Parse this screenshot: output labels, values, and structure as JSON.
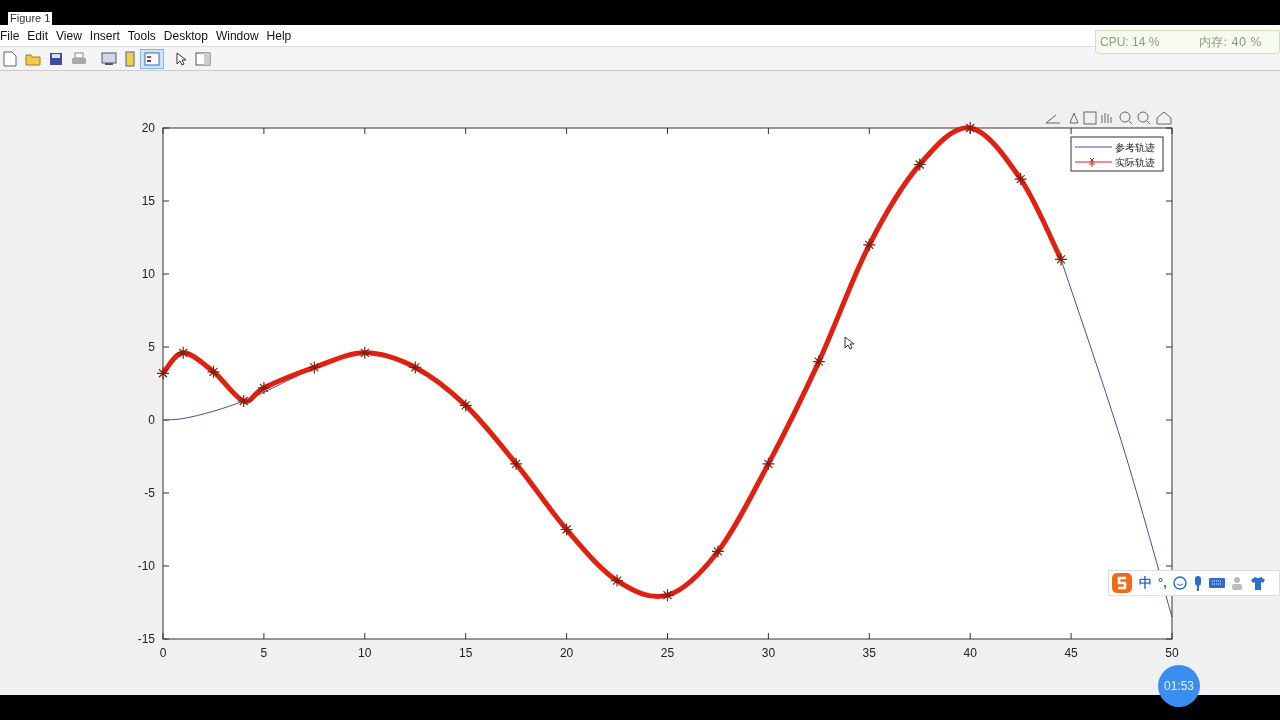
{
  "window": {
    "title": "Figure 1"
  },
  "menu": [
    "File",
    "Edit",
    "View",
    "Insert",
    "Tools",
    "Desktop",
    "Window",
    "Help"
  ],
  "toolbar": [
    {
      "kind": "new",
      "selected": false
    },
    {
      "kind": "open",
      "selected": false
    },
    {
      "kind": "save",
      "selected": false
    },
    {
      "kind": "print",
      "selected": false
    },
    {
      "kind": "link",
      "selected": false
    },
    {
      "kind": "colorbar",
      "selected": false
    },
    {
      "kind": "legend",
      "selected": true
    },
    {
      "kind": "pointer",
      "selected": false
    },
    {
      "kind": "panel",
      "selected": false
    }
  ],
  "monitor": {
    "cpu": "CPU: 14 %",
    "memory": "内存: 40 %"
  },
  "chart_data": {
    "type": "line",
    "x": [
      0,
      1,
      2.5,
      4,
      5,
      7.5,
      10,
      12.5,
      15,
      17.5,
      20,
      22.5,
      25,
      27.5,
      30,
      32.5,
      35,
      37.5,
      40,
      42.5,
      44.5,
      47.5,
      50
    ],
    "series": [
      {
        "name": "参考轨迹",
        "color": "#4a4aa0",
        "values": [
          0,
          0.1,
          0.6,
          1.3,
          1.9,
          3.6,
          null,
          null,
          null,
          null,
          null,
          null,
          null,
          null,
          null,
          null,
          null,
          null,
          null,
          null,
          11,
          -1.5,
          -13.5
        ]
      },
      {
        "name": "实际轨迹",
        "color": "#e02010",
        "line_style": "solid",
        "marker": "cross",
        "values": [
          3.2,
          4.6,
          3.3,
          1.3,
          2.2,
          3.6,
          4.6,
          3.6,
          1,
          -3,
          -7.5,
          -11,
          -12,
          -9,
          -3,
          4,
          12,
          17.5,
          20,
          16.5,
          11,
          null,
          null
        ]
      }
    ],
    "legend": true,
    "xlim": [
      0,
      50
    ],
    "ylim": [
      -15,
      20
    ],
    "xticks": [
      0,
      5,
      10,
      15,
      20,
      25,
      30,
      35,
      40,
      45,
      50
    ],
    "yticks": [
      -15,
      -10,
      -5,
      0,
      5,
      10,
      15,
      20
    ]
  },
  "ime": {
    "label": "中",
    "punct": "°,"
  },
  "timer": "01:53"
}
